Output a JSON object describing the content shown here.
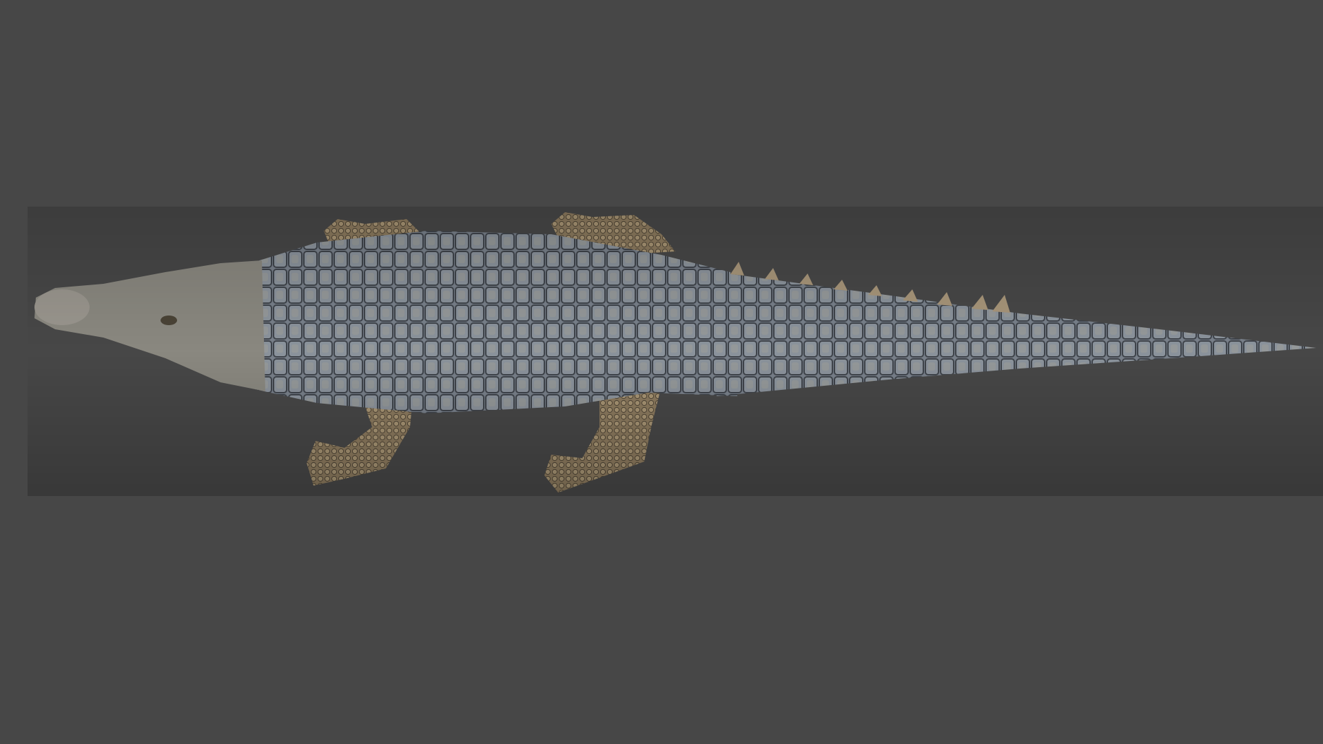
{
  "scene": {
    "subject": "crocodile-3d-render",
    "colors": {
      "background": "#474747",
      "back_scales": "#7c8590",
      "back_scales_dark": "#4b5058",
      "flank": "#8a8070",
      "legs": "#8f7a5c",
      "head": "#8c8a84"
    }
  }
}
